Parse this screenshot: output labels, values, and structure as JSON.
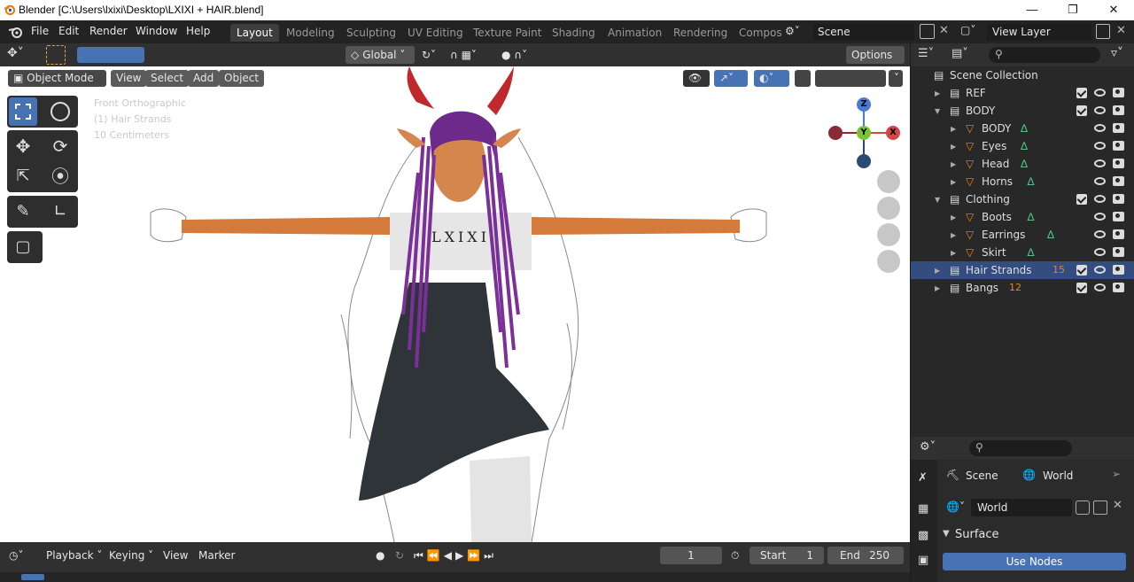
{
  "window": {
    "title": "Blender [C:\\Users\\lxixi\\Desktop\\LXIXI + HAIR.blend]"
  },
  "menu": [
    "File",
    "Edit",
    "Render",
    "Window",
    "Help"
  ],
  "workspaces": [
    "Layout",
    "Modeling",
    "Sculpting",
    "UV Editing",
    "Texture Paint",
    "Shading",
    "Animation",
    "Rendering",
    "Compos"
  ],
  "scene_name": "Scene",
  "view_layer": "View Layer",
  "toolbar": {
    "orientation": "Global",
    "options": "Options"
  },
  "viewport": {
    "mode": "Object Mode",
    "menus": [
      "View",
      "Select",
      "Add",
      "Object"
    ],
    "overlay_lines": [
      "Front Orthographic",
      "(1) Hair Strands",
      "10 Centimeters"
    ],
    "shirt_text": "LXIXI",
    "gizmo": {
      "z": "Z",
      "y": "Y",
      "x": "X"
    }
  },
  "outliner": {
    "rows": [
      {
        "label": "Scene Collection",
        "indent": 0,
        "kind": "scene"
      },
      {
        "label": "REF",
        "indent": 1,
        "kind": "collection"
      },
      {
        "label": "BODY",
        "indent": 1,
        "kind": "collection"
      },
      {
        "label": "BODY",
        "indent": 2,
        "kind": "object"
      },
      {
        "label": "Eyes",
        "indent": 2,
        "kind": "object"
      },
      {
        "label": "Head",
        "indent": 2,
        "kind": "object"
      },
      {
        "label": "Horns",
        "indent": 2,
        "kind": "object"
      },
      {
        "label": "Clothing",
        "indent": 1,
        "kind": "collection"
      },
      {
        "label": "Boots",
        "indent": 2,
        "kind": "object"
      },
      {
        "label": "Earrings",
        "indent": 2,
        "kind": "object"
      },
      {
        "label": "Skirt",
        "indent": 2,
        "kind": "object"
      },
      {
        "label": "Hair Strands",
        "indent": 1,
        "kind": "collection",
        "selected": true,
        "count": "15"
      },
      {
        "label": "Bangs",
        "indent": 1,
        "kind": "collection",
        "count": "12"
      }
    ]
  },
  "properties": {
    "tabs": [
      "Scene",
      "World"
    ],
    "world_name": "World",
    "section": "Surface",
    "use_nodes": "Use Nodes"
  },
  "timeline": {
    "menus": [
      "Playback",
      "Keying",
      "View",
      "Marker"
    ],
    "current_frame": "1",
    "start_label": "Start",
    "start_value": "1",
    "end_label": "End",
    "end_value": "250"
  },
  "colors": {
    "accent": "#4772b3",
    "object_orange": "#e0842d",
    "mesh_green": "#56c284"
  }
}
